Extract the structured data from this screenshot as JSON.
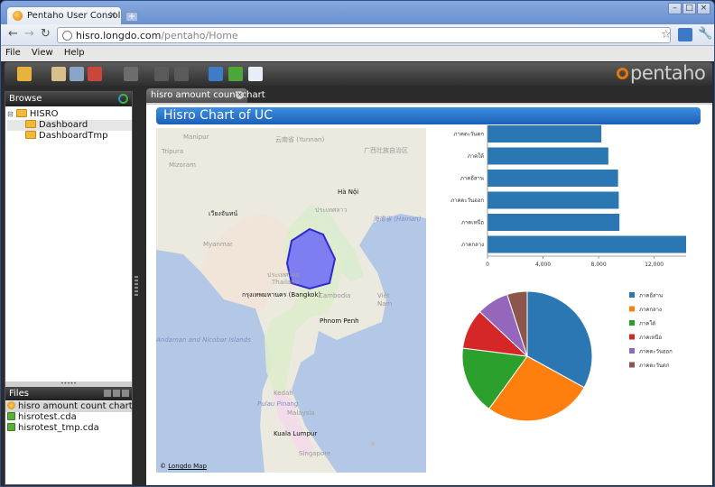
{
  "browser": {
    "tab_title": "Pentaho User Console - hisro",
    "tab_close": "×",
    "new_tab": "+",
    "url_host": "hisro.longdo.com",
    "url_path": "/pentaho/Home",
    "window_buttons": [
      "–",
      "□",
      "×"
    ]
  },
  "menu": {
    "items": [
      "File",
      "View",
      "Help"
    ]
  },
  "brand": {
    "logo_text": "pentaho",
    "accent": "#e07a10"
  },
  "browse": {
    "header": "Browse",
    "tree": {
      "root": "HISRO",
      "children": [
        "Dashboard",
        "DashboardTmp"
      ]
    },
    "splitter": "•••••"
  },
  "files": {
    "header": "Files",
    "items": [
      "hisro amount count chart",
      "hisrotest.cda",
      "hisrotest_tmp.cda"
    ]
  },
  "content_tab": {
    "label": "hisro amount count chart",
    "close": "×"
  },
  "chart_title": "Hisro Chart of UC",
  "map": {
    "copyright_symbol": "©",
    "copyright_link": "Longdo Map",
    "labels": {
      "manipur": "Manipur",
      "yunnan": "云南省 (Yunnan)",
      "guangxi": "广西壮族自治区",
      "tripura": "Tripura",
      "mizoram": "Mizoram",
      "hanoi": "Hà Nội",
      "laos": "ประเทศลาว",
      "hainan": "海南省 (Hainan)",
      "myanmar": "Myanmar",
      "thai": "ประเทศไทย",
      "thailand": "Thailand",
      "bangkok": "กรุงเทพมหานคร (Bangkok)",
      "cambodia": "Cambodia",
      "vietnam_viet": "Việt",
      "vietnam_nam": "Nam",
      "phnompenh": "Phnom Penh",
      "andaman": "Andaman and Nicobar Islands",
      "penang": "Pulau Pinang",
      "kedah": "Kedah",
      "malaysia": "Malaysia",
      "kl": "Kuala Lumpur",
      "singapore": "Singapore",
      "vientiane": "เวียงจันทน์"
    }
  },
  "chart_data": [
    {
      "type": "bar",
      "orientation": "horizontal",
      "categories": [
        "ภาคตะวันตก",
        "ภาคใต้",
        "ภาคอีสาน",
        "ภาคตะวันออก",
        "ภาคเหนือ",
        "ภาคกลาง"
      ],
      "values": [
        8200,
        8700,
        9400,
        9450,
        9500,
        14300
      ],
      "xlim": [
        0,
        14300
      ],
      "ticks": [
        0,
        4000,
        8000,
        12000
      ],
      "tick_labels": [
        "0",
        "4,000",
        "8,000",
        "12,000"
      ],
      "color": "#2a77b4",
      "grid": false
    },
    {
      "type": "pie",
      "labels": [
        "ภาคอีสาน",
        "ภาคกลาง",
        "ภาคใต้",
        "ภาคเหนือ",
        "ภาคตะวันออก",
        "ภาคตะวันตก"
      ],
      "values": [
        33,
        27,
        17,
        10,
        8,
        5
      ],
      "colors": [
        "#2a77b4",
        "#ff7f0e",
        "#2ca02c",
        "#d62728",
        "#9467bd",
        "#8c564b"
      ],
      "legend_position": "right"
    }
  ]
}
